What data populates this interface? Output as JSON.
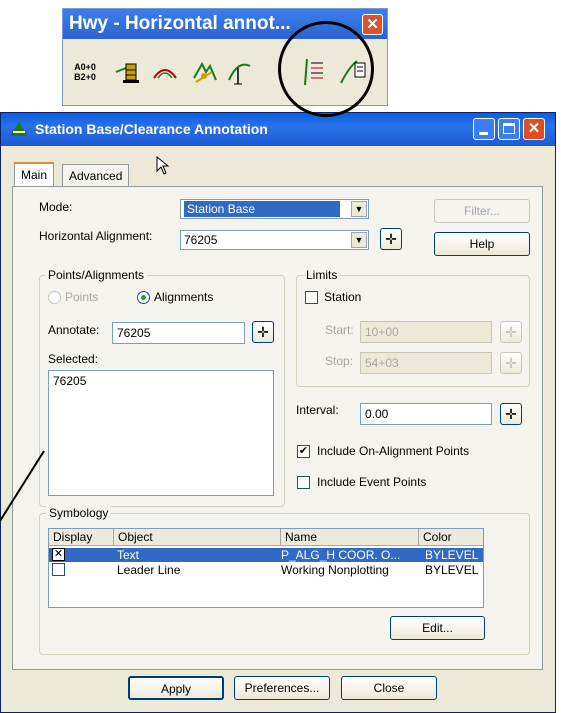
{
  "toolbar": {
    "title": "Hwy - Horizontal annot...",
    "close": "✕",
    "icons": [
      "station-offset-icon",
      "building-icon",
      "curve-icon",
      "tree-icon",
      "tangent-icon",
      "station-base-clearance-icon",
      "leader-icon"
    ],
    "station_icon_line1": "A0+0",
    "station_icon_line2": "B2+0"
  },
  "dialog": {
    "title": "Station Base/Clearance Annotation",
    "tabs": [
      "Main",
      "Advanced"
    ],
    "mode_label": "Mode:",
    "mode_value": "Station Base",
    "halign_label": "Horizontal Alignment:",
    "halign_value": "76205",
    "filter_button": "Filter...",
    "help_button": "Help",
    "points_group": {
      "title": "Points/Alignments",
      "points_label": "Points",
      "alignments_label": "Alignments",
      "annotate_label": "Annotate:",
      "annotate_value": "76205",
      "selected_label": "Selected:",
      "selected_items": [
        "76205"
      ]
    },
    "limits_group": {
      "title": "Limits",
      "station_label": "Station",
      "start_label": "Start:",
      "start_value": "10+00",
      "stop_label": "Stop:",
      "stop_value": "54+03"
    },
    "interval_label": "Interval:",
    "interval_value": "0.00",
    "include_on_alignment": "Include On-Alignment Points",
    "include_event": "Include Event Points",
    "symbology": {
      "title": "Symbology",
      "columns": [
        "Display",
        "Object",
        "Name",
        "Color"
      ],
      "rows": [
        {
          "object": "Text",
          "name": "P_ALG_H COOR. O...",
          "color": "BYLEVEL",
          "checked": true
        },
        {
          "object": "Leader Line",
          "name": "Working Nonplotting",
          "color": "BYLEVEL",
          "checked": false
        }
      ],
      "edit_button": "Edit..."
    },
    "apply_button": "Apply",
    "preferences_button": "Preferences...",
    "close_button": "Close",
    "colors": {
      "selection": "#316ac5",
      "titlebar": "#0a5ee0"
    }
  }
}
